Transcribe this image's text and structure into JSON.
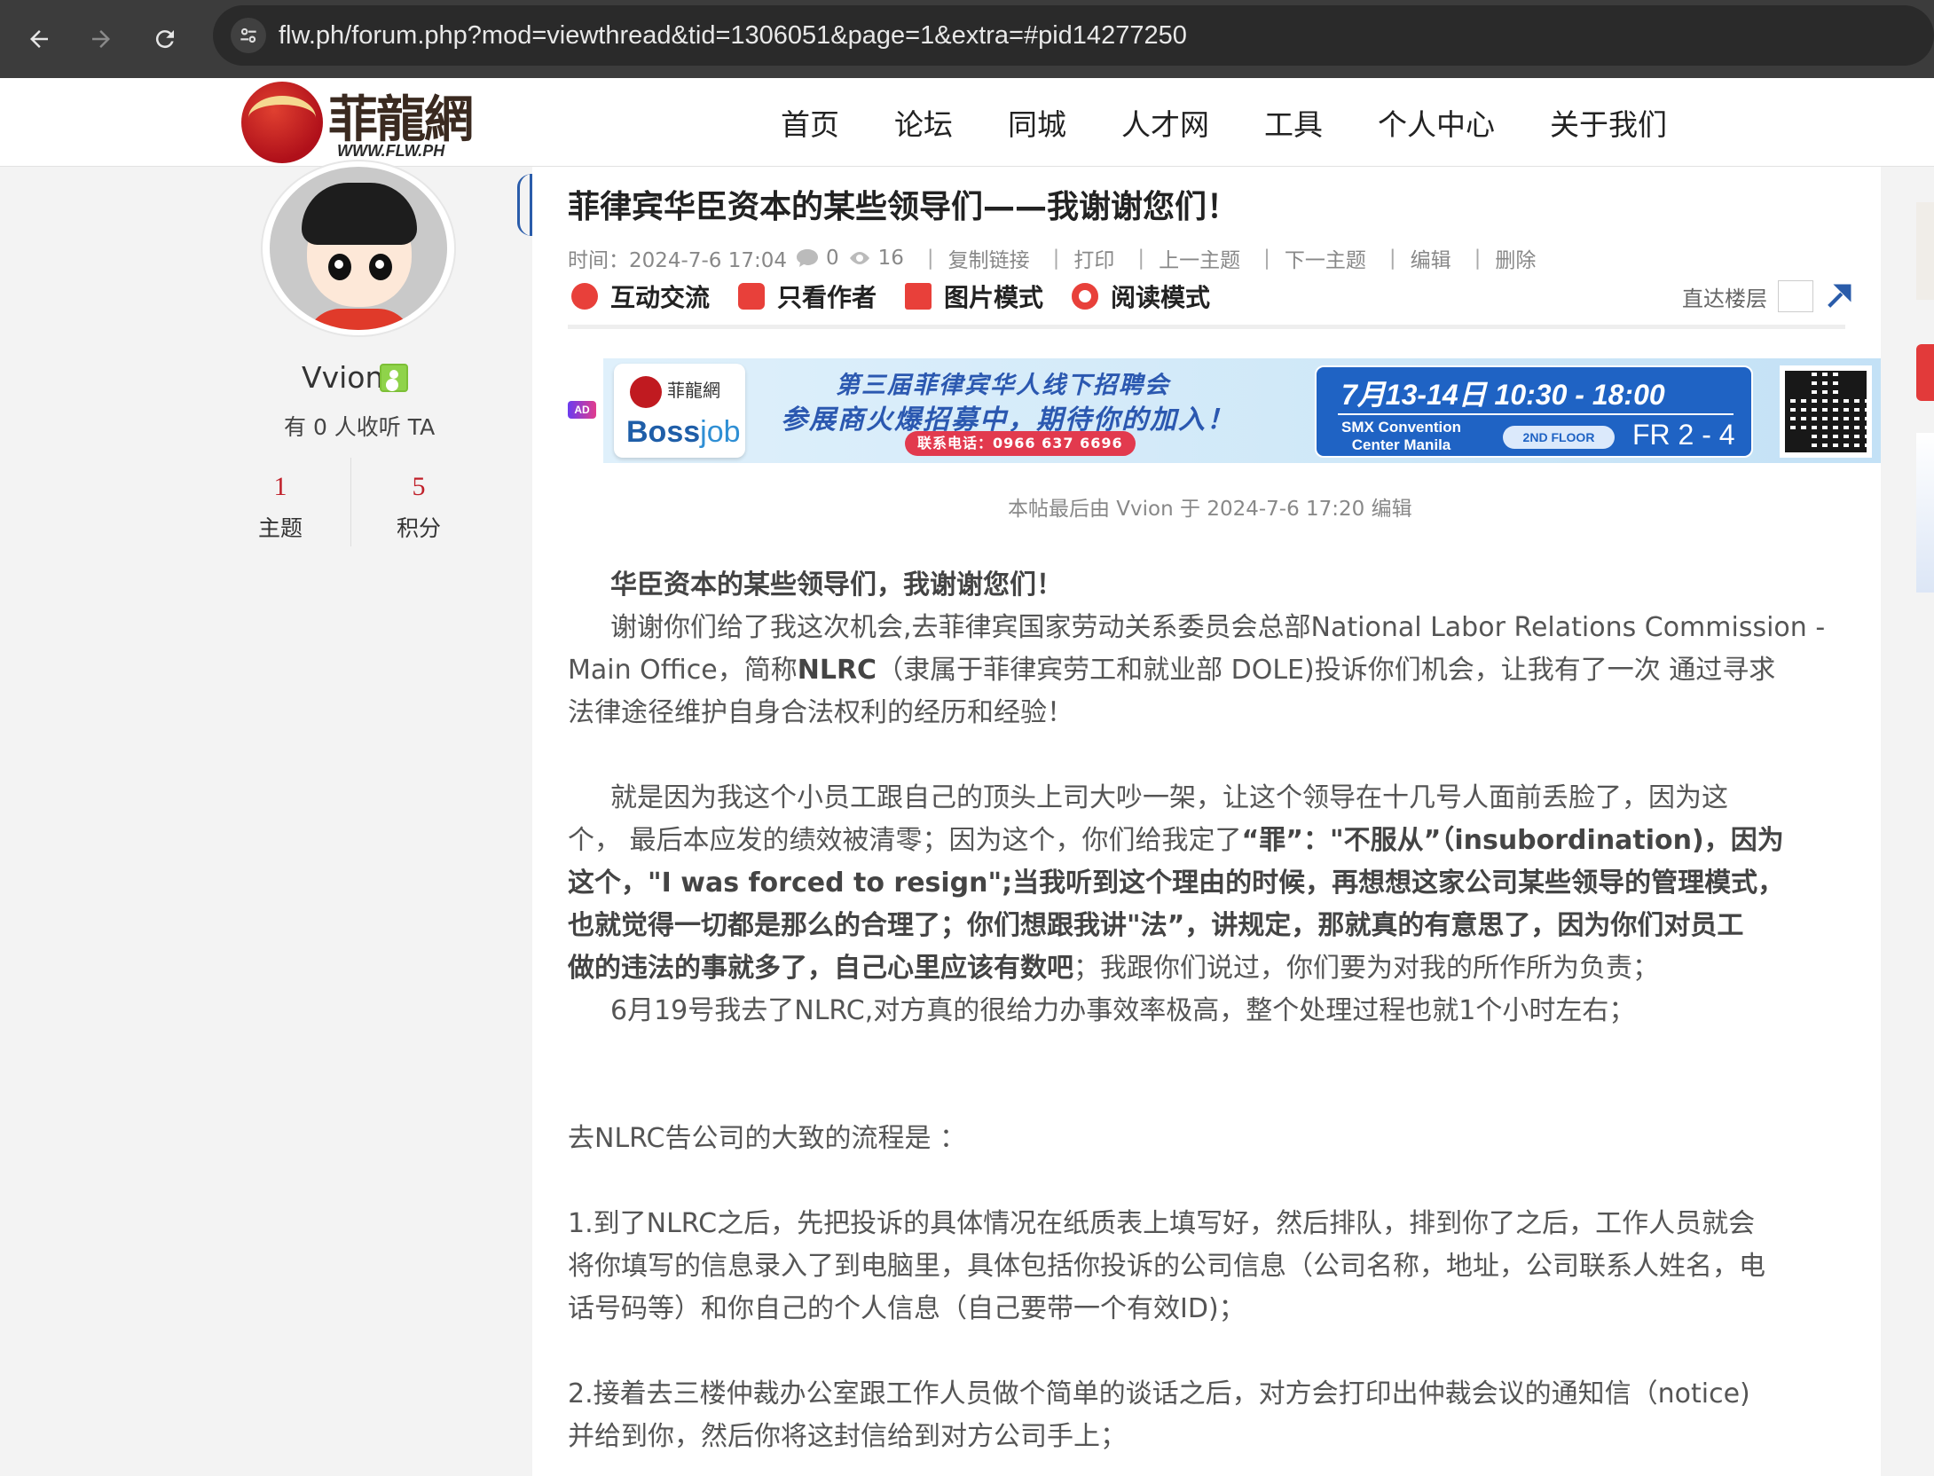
{
  "browser": {
    "url": "flw.ph/forum.php?mod=viewthread&tid=1306051&page=1&extra=#pid14277250"
  },
  "site": {
    "logo_cn": "菲龍網",
    "logo_en": "WWW.FLW.PH",
    "nav": [
      "首页",
      "论坛",
      "同城",
      "人才网",
      "工具",
      "个人中心",
      "关于我们"
    ]
  },
  "user": {
    "name": "Vvion",
    "listeners": "有 0 人收听 TA",
    "stats": [
      {
        "num": "1",
        "label": "主题"
      },
      {
        "num": "5",
        "label": "积分"
      }
    ]
  },
  "thread": {
    "title": "菲律宾华臣资本的某些领导们——我谢谢您们！",
    "time": "时间：2024-7-6 17:04",
    "replies": "0",
    "views": "16",
    "links": [
      "复制链接",
      "打印",
      "上一主题",
      "下一主题",
      "编辑",
      "删除"
    ],
    "tools": [
      "互动交流",
      "只看作者",
      "图片模式",
      "阅读模式"
    ],
    "jump_label": "直达楼层",
    "edited_note": "本帖最后由 Vvion 于 2024-7-6 17:20 编辑"
  },
  "ad": {
    "tag": "AD",
    "logo_cn": "菲龍網",
    "brand_a": "Boss",
    "brand_b": "job",
    "line1": "第三届菲律宾华人线下招聘会",
    "line2": "参展商火爆招募中，期待你的加入！",
    "phone": "联系电话：0966 637 6696",
    "dates": "7月13-14日  10:30 - 18:00",
    "venue_1": "SMX Convention",
    "venue_2": "Center Manila",
    "floor": "2ND FLOOR",
    "room": "FR 2 - 4"
  },
  "post": {
    "p1": "华臣资本的某些领导们，我谢谢您们！",
    "p2a": "谢谢你们给了我这次机会,去菲律宾国家劳动关系委员会总部National Labor Relations Commission -",
    "p2b_1": "Main Office，简称",
    "p2b_bold": "NLRC",
    "p2b_2": "（隶属于菲律宾劳工和就业部 DOLE)投诉你们机会，让我有了一次 通过寻求",
    "p2c": "法律途径维护自身合法权利的经历和经验！",
    "p3a": "就是因为我这个小员工跟自己的顶头上司大吵一架，让这个领导在十几号人面前丢脸了，因为这",
    "p3b_1": "个，  最后本应发的绩效被清零；因为这个，你们给我定了",
    "p3b_bold": "“罪”：\"不服从”（insubordination)，因为",
    "p3c_bold": "这个，\"I was forced to resign\";当我听到这个理由的时候，再想想这家公司某些领导的管理模式，",
    "p3d_bold": "也就觉得一切都是那么的合理了；你们想跟我讲\"法”，讲规定，那就真的有意思了，因为你们对员工",
    "p3e_bold": "做的违法的事就多了，自己心里应该有数吧",
    "p3e_2": "；我跟你们说过，你们要为对我的所作所为负责；",
    "p4": "6月19号我去了NLRC,对方真的很给力办事效率极高，整个处理过程也就1个小时左右；",
    "p5": "去NLRC告公司的大致的流程是 ：",
    "p6a": "1.到了NLRC之后，先把投诉的具体情况在纸质表上填写好，然后排队，排到你了之后，工作人员就会",
    "p6b": "将你填写的信息录入了到电脑里，具体包括你投诉的公司信息（公司名称，地址，公司联系人姓名，电",
    "p6c": "话号码等）和你自己的个人信息（自己要带一个有效ID)；",
    "p7a": "2.接着去三楼仲裁办公室跟工作人员做个简单的谈话之后，对方会打印出仲裁会议的通知信（notice)",
    "p7b": "并给到你，然后你将这封信给到对方公司手上；"
  }
}
